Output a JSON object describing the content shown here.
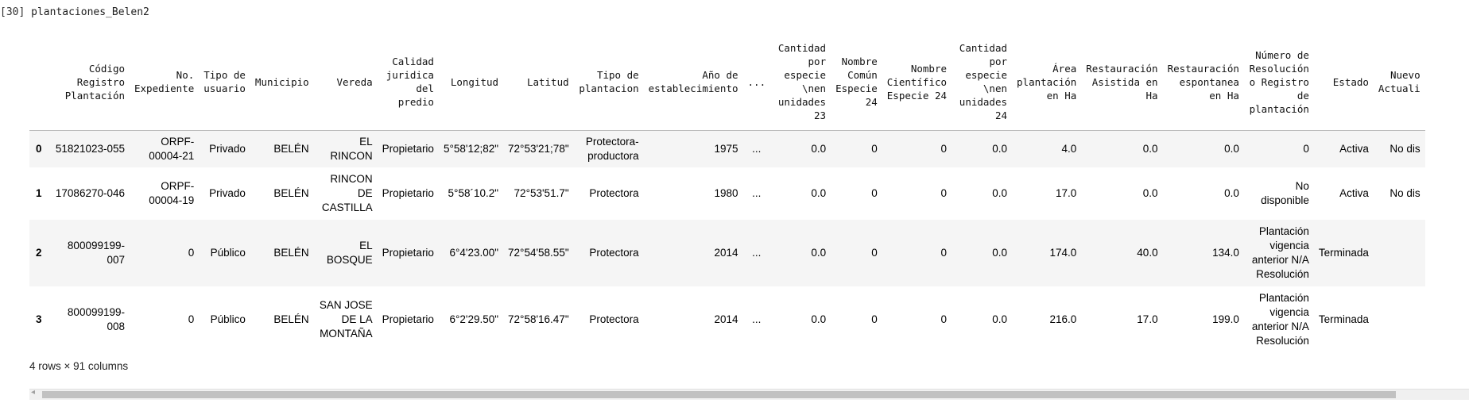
{
  "cell": {
    "prompt": "[30]",
    "code": "plantaciones_Belen2"
  },
  "table": {
    "columns": [
      "",
      "Código Registro Plantación",
      "No. Expediente",
      "Tipo de usuario",
      "Municipio",
      "Vereda",
      "Calidad juridica del predio",
      "Longitud",
      "Latitud",
      "Tipo de plantacion",
      "Año de establecimiento",
      "...",
      "Cantidad por especie \\nen unidades 23",
      "Nombre Común Especie 24",
      "Nombre Científico Especie 24",
      "Cantidad por especie \\nen unidades 24",
      "Área plantación en Ha",
      "Restauración Asistida en Ha",
      "Restauración espontanea en Ha",
      "Número de Resolución o Registro de plantación",
      "Estado",
      "Nuevo Actuali"
    ],
    "rows": [
      [
        "0",
        "51821023-055",
        "ORPF-00004-21",
        "Privado",
        "BELÉN",
        "EL RINCON",
        "Propietario",
        "5°58'12;82\"",
        "72°53'21;78\"",
        "Protectora-productora",
        "1975",
        "...",
        "0.0",
        "0",
        "0",
        "0.0",
        "4.0",
        "0.0",
        "0.0",
        "0",
        "Activa",
        "No dis"
      ],
      [
        "1",
        "17086270-046",
        "ORPF-00004-19",
        "Privado",
        "BELÉN",
        "RINCON DE CASTILLA",
        "Propietario",
        "5°58´10.2\"",
        "72°53'51.7\"",
        "Protectora",
        "1980",
        "...",
        "0.0",
        "0",
        "0",
        "0.0",
        "17.0",
        "0.0",
        "0.0",
        "No disponible",
        "Activa",
        "No dis"
      ],
      [
        "2",
        "800099199-007",
        "0",
        "Público",
        "BELÉN",
        "EL BOSQUE",
        "Propietario",
        "6°4'23.00\"",
        "72°54'58.55\"",
        "Protectora",
        "2014",
        "...",
        "0.0",
        "0",
        "0",
        "0.0",
        "174.0",
        "40.0",
        "134.0",
        "Plantación vigencia anterior N/A Resolución",
        "Terminada",
        ""
      ],
      [
        "3",
        "800099199-008",
        "0",
        "Público",
        "BELÉN",
        "SAN JOSE DE LA MONTAÑA",
        "Propietario",
        "6°2'29.50\"",
        "72°58'16.47\"",
        "Protectora",
        "2014",
        "...",
        "0.0",
        "0",
        "0",
        "0.0",
        "216.0",
        "17.0",
        "199.0",
        "Plantación vigencia anterior N/A Resolución",
        "Terminada",
        ""
      ]
    ]
  },
  "shape_text": "4 rows × 91 columns"
}
